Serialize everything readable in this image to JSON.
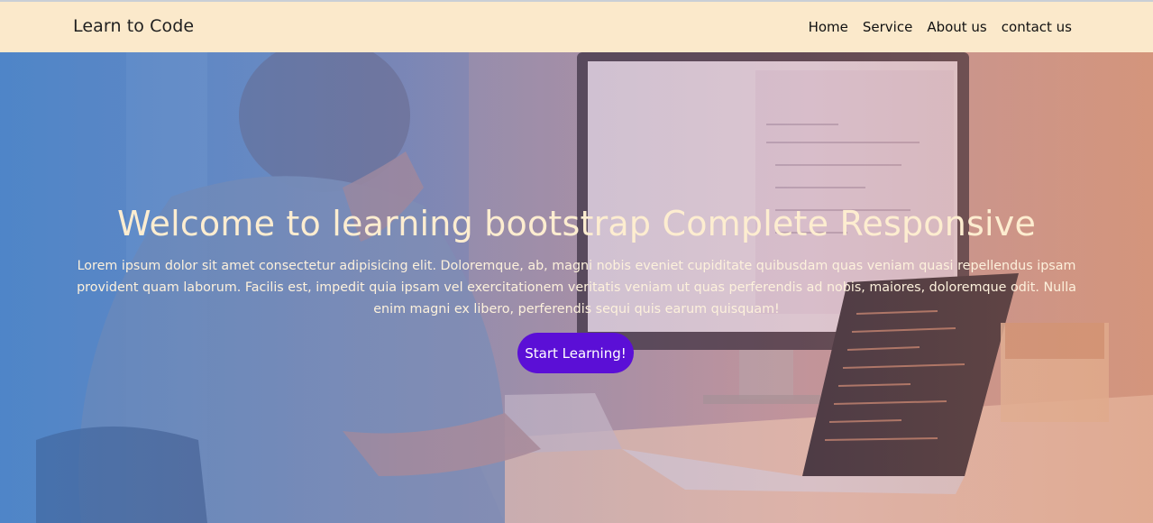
{
  "navbar": {
    "brand": "Learn to Code",
    "links": [
      "Home",
      "Service",
      "About us",
      "contact us"
    ]
  },
  "hero": {
    "title": "Welcome to learning bootstrap Complete Responsive",
    "text": "Lorem ipsum dolor sit amet consectetur adipisicing elit. Doloremque, ab, magni nobis eveniet cupiditate quibusdam quas veniam quasi repellendus ipsam provident quam laborum. Facilis est, impedit quia ipsam vel exercitationem veritatis veniam ut quas perferendis ad nobis, maiores, doloremque odit. Nulla enim magni ex libero, perferendis sequi quis earum quisquam!",
    "button_label": "Start Learning!",
    "background_image": "person-coding-at-desk-photo"
  },
  "colors": {
    "navbar_bg": "#fbe9cb",
    "button_bg": "#5b0fd6",
    "title_color": "#fdedd0",
    "gradient_left": "#4a7fc2",
    "gradient_right": "#d59a7e"
  }
}
